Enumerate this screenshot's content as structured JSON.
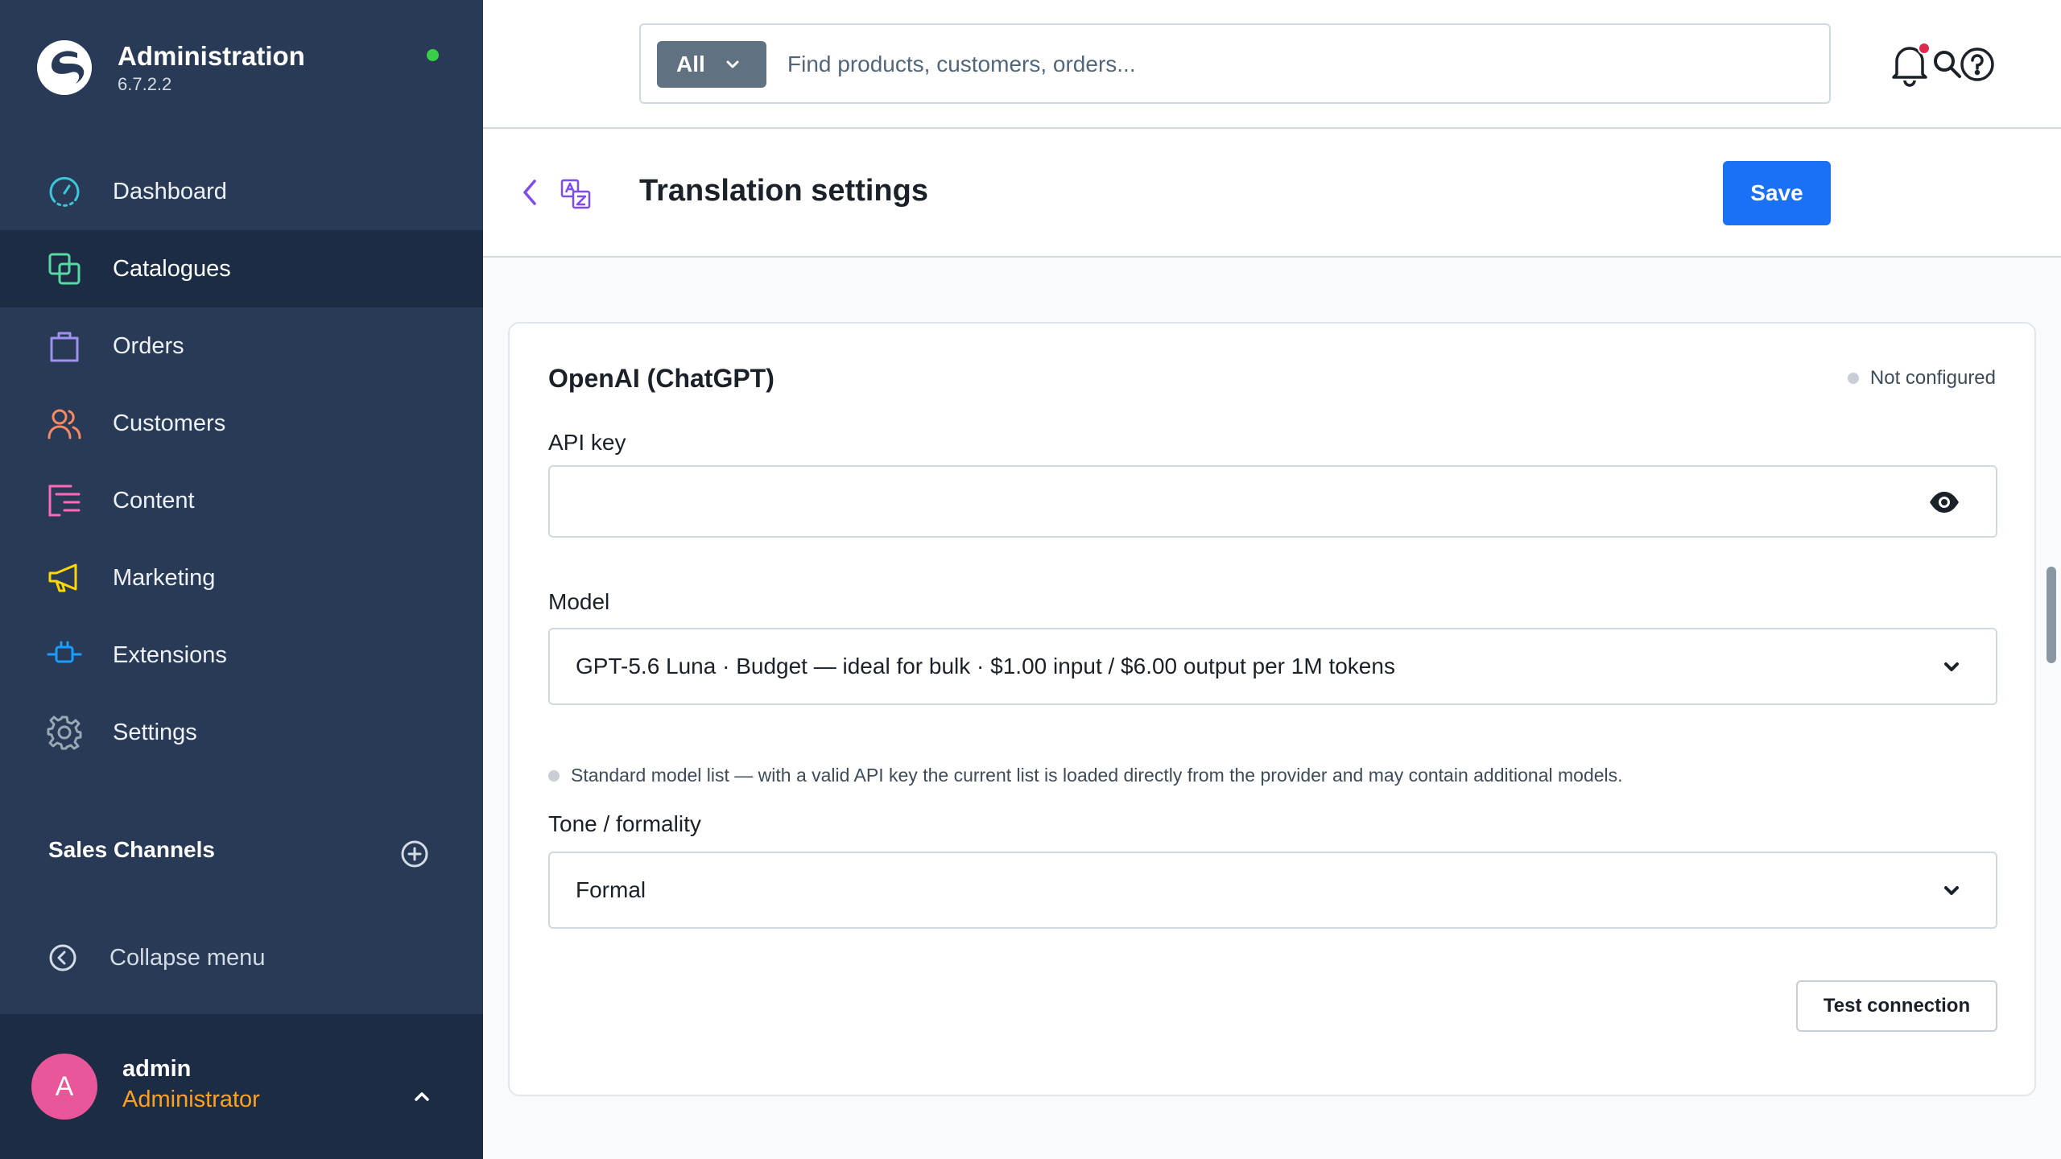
{
  "app": {
    "title": "Administration",
    "version": "6.7.2.2"
  },
  "sidebar": {
    "items": [
      {
        "label": "Dashboard",
        "icon": "dashboard-icon",
        "color": "#3cc6d9"
      },
      {
        "label": "Catalogues",
        "icon": "catalogues-icon",
        "color": "#57d9a3",
        "active": true
      },
      {
        "label": "Orders",
        "icon": "orders-icon",
        "color": "#a092f0"
      },
      {
        "label": "Customers",
        "icon": "customers-icon",
        "color": "#f88962"
      },
      {
        "label": "Content",
        "icon": "content-icon",
        "color": "#ff68b4"
      },
      {
        "label": "Marketing",
        "icon": "marketing-icon",
        "color": "#ffd700"
      },
      {
        "label": "Extensions",
        "icon": "extensions-icon",
        "color": "#189eff"
      },
      {
        "label": "Settings",
        "icon": "settings-icon",
        "color": "#9aa8b5"
      }
    ],
    "sales_channels_title": "Sales Channels",
    "collapse_label": "Collapse menu"
  },
  "user": {
    "initial": "A",
    "name": "admin",
    "role": "Administrator"
  },
  "search": {
    "scope": "All",
    "placeholder": "Find products, customers, orders..."
  },
  "page": {
    "title": "Translation settings",
    "save_label": "Save"
  },
  "card": {
    "title": "OpenAI (ChatGPT)",
    "status": "Not configured",
    "api_key_label": "API key",
    "api_key_value": "",
    "model_label": "Model",
    "model_value": "GPT-5.6 Luna · Budget — ideal for bulk · $1.00 input / $6.00 output per 1M tokens",
    "hint": "Standard model list — with a valid API key the current list is loaded directly from the provider and may contain additional models.",
    "tone_label": "Tone / formality",
    "tone_value": "Formal",
    "test_label": "Test connection"
  },
  "colors": {
    "sidebar_bg": "#283a55",
    "sidebar_active": "#1c2c45",
    "primary": "#1b71f5",
    "online": "#37d046",
    "notification": "#de294c",
    "role": "#ffa11e",
    "avatar": "#e9579a"
  }
}
